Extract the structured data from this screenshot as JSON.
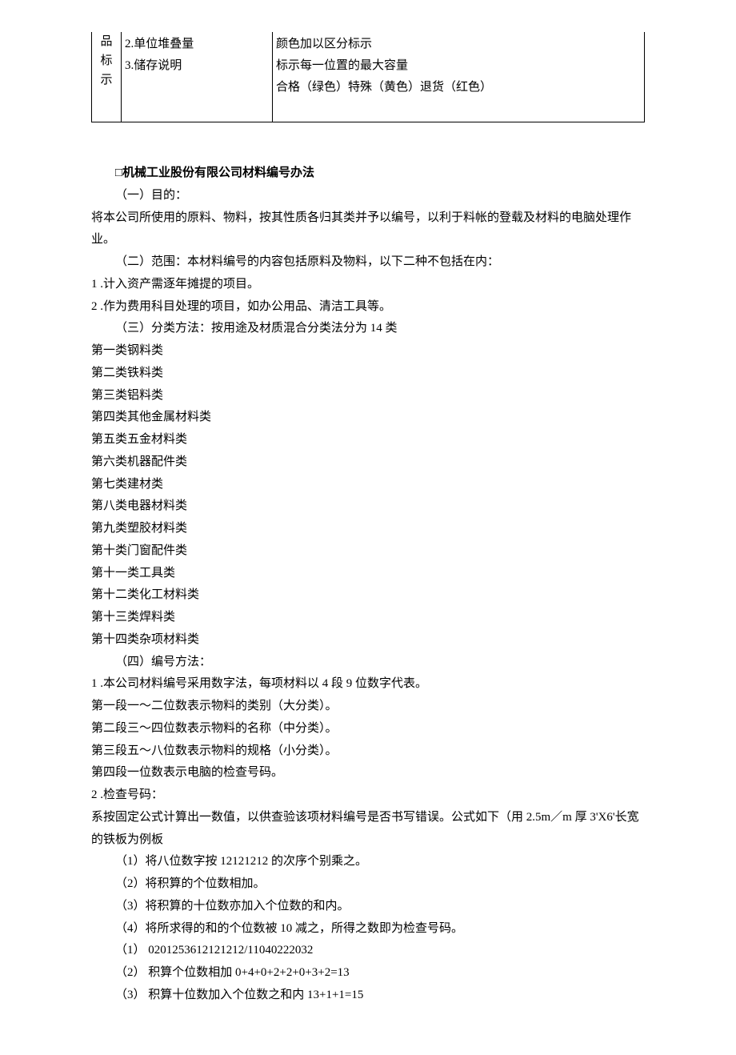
{
  "table": {
    "row": {
      "col0": [
        "品",
        "标",
        "示"
      ],
      "col1_lines": [
        "2.单位堆叠量",
        "3.储存说明"
      ],
      "col2_lines": [
        "颜色加以区分标示",
        "标示每一位置的最大容量",
        "合格（绿色）特殊（黄色）退货（红色）"
      ]
    }
  },
  "body": {
    "title": "□机械工业股份有限公司材料编号办法",
    "s1_heading": "（一）目的：",
    "s1_p1": "将本公司所使用的原料、物料，按其性质各归其类并予以编号，以利于料帐的登载及材料的电脑处理作业。",
    "s2_heading": "（二）范围：本材料编号的内容包括原料及物料，以下二种不包括在内：",
    "s2_li1": "1 .计入资产需逐年摊提的项目。",
    "s2_li2": "2 .作为费用科目处理的项目，如办公用品、清洁工具等。",
    "s3_heading": "（三）分类方法：按用途及材质混合分类法分为 14 类",
    "cat": [
      "第一类钢料类",
      "第二类铁料类",
      "第三类铝料类",
      "第四类其他金属材料类",
      "第五类五金材料类",
      "第六类机器配件类",
      "第七类建材类",
      "第八类电器材料类",
      "第九类塑胶材料类",
      "第十类门窗配件类",
      "第十一类工具类",
      "第十二类化工材料类",
      "第十三类焊料类",
      "第十四类杂项材料类"
    ],
    "s4_heading": "（四）编号方法：",
    "s4_li1": "1 .本公司材料编号采用数字法，每项材料以 4 段 9 位数字代表。",
    "seg1": "第一段一～二位数表示物料的类别（大分类）。",
    "seg2": "第二段三～四位数表示物料的名称（中分类）。",
    "seg3": "第三段五～八位数表示物料的规格（小分类）。",
    "seg4": "第四段一位数表示电脑的检查号码。",
    "s4_li2": "2 .检查号码：",
    "s4_p2": "系按固定公式计算出一数值，以供查验该项材料编号是否书写错误。公式如下（用 2.5m／m 厚 3'X6'长宽的铁板为例板",
    "step1": "（1）将八位数字按 12121212 的次序个别乘之。",
    "step2": "（2）将积算的个位数相加。",
    "step3": "（3）将积算的十位数亦加入个位数的和内。",
    "step4": "（4）将所求得的和的个位数被 10 减之，所得之数即为检查号码。",
    "calc1": "（1）  0201253612121212/11040222032",
    "calc2": "（2）  积算个位数相加 0+4+0+2+2+0+3+2=13",
    "calc3": "（3）  积算十位数加入个位数之和内 13+1+1=15"
  }
}
